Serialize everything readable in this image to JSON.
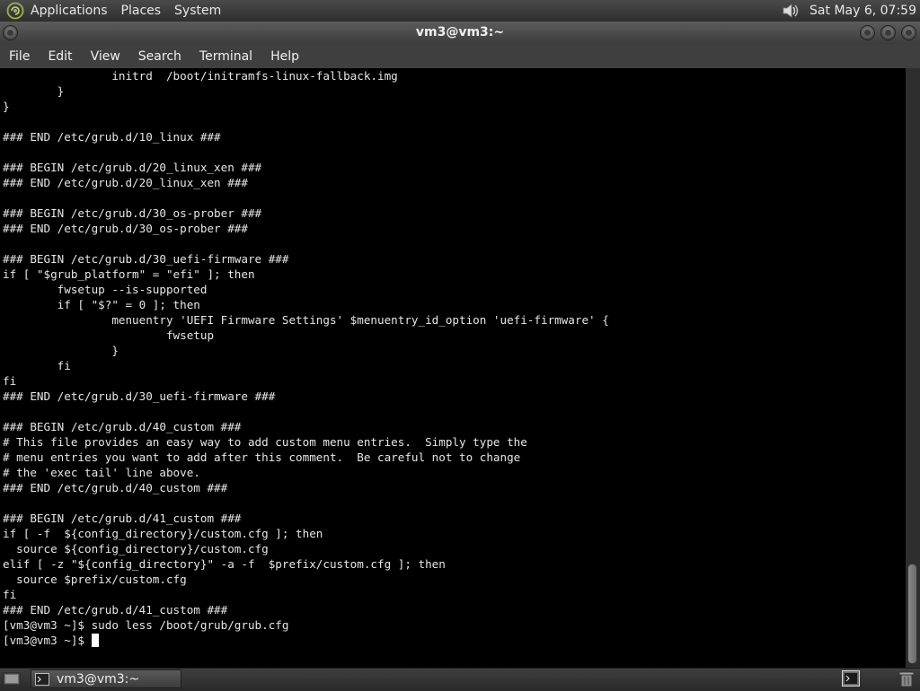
{
  "top_panel": {
    "menus": [
      "Applications",
      "Places",
      "System"
    ],
    "clock": "Sat May  6, 07:59",
    "icons": {
      "logo": "gnome-foot-icon",
      "volume": "volume-icon"
    }
  },
  "window": {
    "title": "vm3@vm3:~",
    "menus": [
      "File",
      "Edit",
      "View",
      "Search",
      "Terminal",
      "Help"
    ]
  },
  "terminal": {
    "lines": [
      "                initrd  /boot/initramfs-linux-fallback.img",
      "        }",
      "}",
      "",
      "### END /etc/grub.d/10_linux ###",
      "",
      "### BEGIN /etc/grub.d/20_linux_xen ###",
      "### END /etc/grub.d/20_linux_xen ###",
      "",
      "### BEGIN /etc/grub.d/30_os-prober ###",
      "### END /etc/grub.d/30_os-prober ###",
      "",
      "### BEGIN /etc/grub.d/30_uefi-firmware ###",
      "if [ \"$grub_platform\" = \"efi\" ]; then",
      "        fwsetup --is-supported",
      "        if [ \"$?\" = 0 ]; then",
      "                menuentry 'UEFI Firmware Settings' $menuentry_id_option 'uefi-firmware' {",
      "                        fwsetup",
      "                }",
      "        fi",
      "fi",
      "### END /etc/grub.d/30_uefi-firmware ###",
      "",
      "### BEGIN /etc/grub.d/40_custom ###",
      "# This file provides an easy way to add custom menu entries.  Simply type the",
      "# menu entries you want to add after this comment.  Be careful not to change",
      "# the 'exec tail' line above.",
      "### END /etc/grub.d/40_custom ###",
      "",
      "### BEGIN /etc/grub.d/41_custom ###",
      "if [ -f  ${config_directory}/custom.cfg ]; then",
      "  source ${config_directory}/custom.cfg",
      "elif [ -z \"${config_directory}\" -a -f  $prefix/custom.cfg ]; then",
      "  source $prefix/custom.cfg",
      "fi",
      "### END /etc/grub.d/41_custom ###",
      "[vm3@vm3 ~]$ sudo less /boot/grub/grub.cfg"
    ],
    "prompt": "[vm3@vm3 ~]$ "
  },
  "bottom_panel": {
    "task_label": "vm3@vm3:~",
    "icons": {
      "show_desktop": "show-desktop-icon",
      "task": "terminal-icon",
      "tray": "terminal-icon",
      "trash": "trash-icon"
    }
  },
  "colors": {
    "terminal_bg": "#000000",
    "terminal_fg": "#e6e6e6",
    "panel": "#3a3a3a"
  }
}
